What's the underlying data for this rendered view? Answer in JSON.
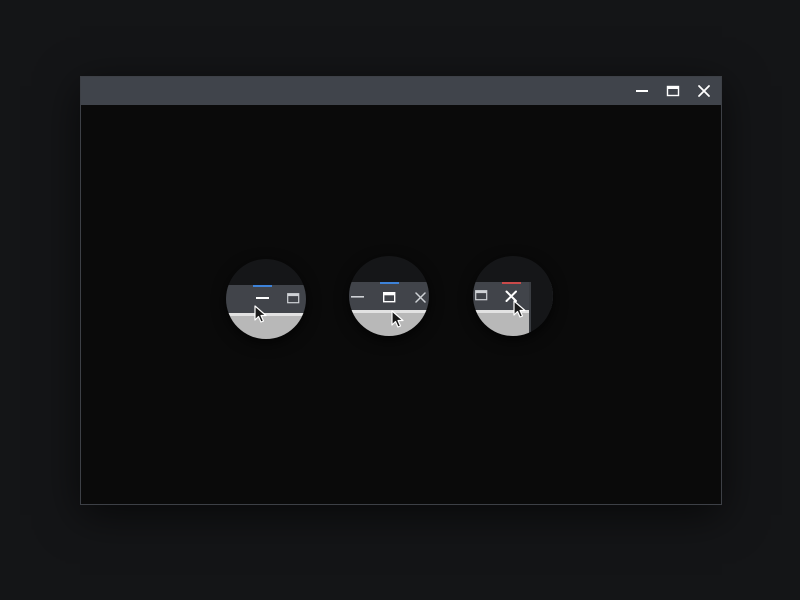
{
  "window": {
    "controls": [
      {
        "icon": "minimize-icon"
      },
      {
        "icon": "maximize-icon"
      },
      {
        "icon": "close-icon"
      }
    ]
  },
  "magnifiers": [
    {
      "target": "minimize-icon",
      "accent": "#3d82d8"
    },
    {
      "target": "maximize-icon",
      "accent": "#3d82d8"
    },
    {
      "target": "close-icon",
      "accent": "#c94a4a"
    }
  ],
  "colors": {
    "desktop": "#141517",
    "titlebar": "#40444b",
    "window_body": "#0a0a0a",
    "icon": "#ffffff",
    "hover_blue": "#3d82d8",
    "hover_red": "#c94a4a"
  }
}
